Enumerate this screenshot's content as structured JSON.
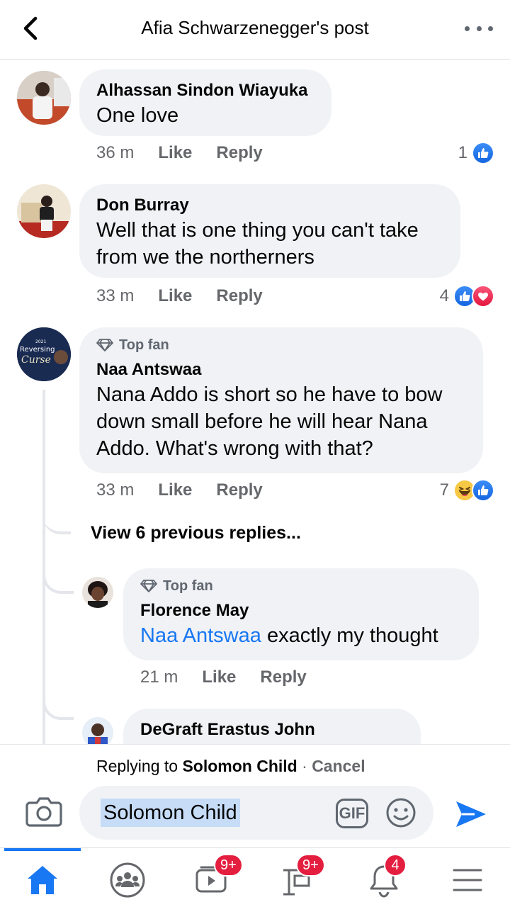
{
  "header": {
    "title": "Afia Schwarzenegger's post"
  },
  "comments": [
    {
      "author": "Alhassan Sindon Wiayuka",
      "text": "One love",
      "time": "36 m",
      "like": "Like",
      "reply": "Reply",
      "count": "1"
    },
    {
      "author": "Don Burray",
      "text": "Well that is one thing you can't take from we the northerners",
      "time": "33 m",
      "like": "Like",
      "reply": "Reply",
      "count": "4"
    },
    {
      "badge": "Top fan",
      "author": "Naa Antswaa",
      "text": "Nana Addo is short so he have to bow down small before he will hear Nana Addo. What's wrong with that?",
      "time": "33 m",
      "like": "Like",
      "reply": "Reply",
      "count": "7",
      "avatar_text": {
        "year": "2021",
        "line1": "Reversing",
        "line2": "Curse"
      }
    }
  ],
  "view_replies": "View 6 previous replies...",
  "replies": [
    {
      "badge": "Top fan",
      "author": "Florence May",
      "mention": "Naa Antswaa",
      "text": " exactly my thought",
      "time": "21 m",
      "like": "Like",
      "reply": "Reply"
    },
    {
      "author": "DeGraft Erastus John"
    }
  ],
  "reply_bar": {
    "prefix": "Replying to ",
    "target": "Solomon Child",
    "separator": " · ",
    "cancel": "Cancel",
    "input_value": "Solomon Child",
    "gif_label": "GIF"
  },
  "nav": {
    "watch_badge": "9+",
    "marketplace_badge": "9+",
    "notifications_badge": "4"
  },
  "colors": {
    "accent": "#1877f2",
    "bubble": "#f0f2f5",
    "badge": "#e41e3f"
  }
}
